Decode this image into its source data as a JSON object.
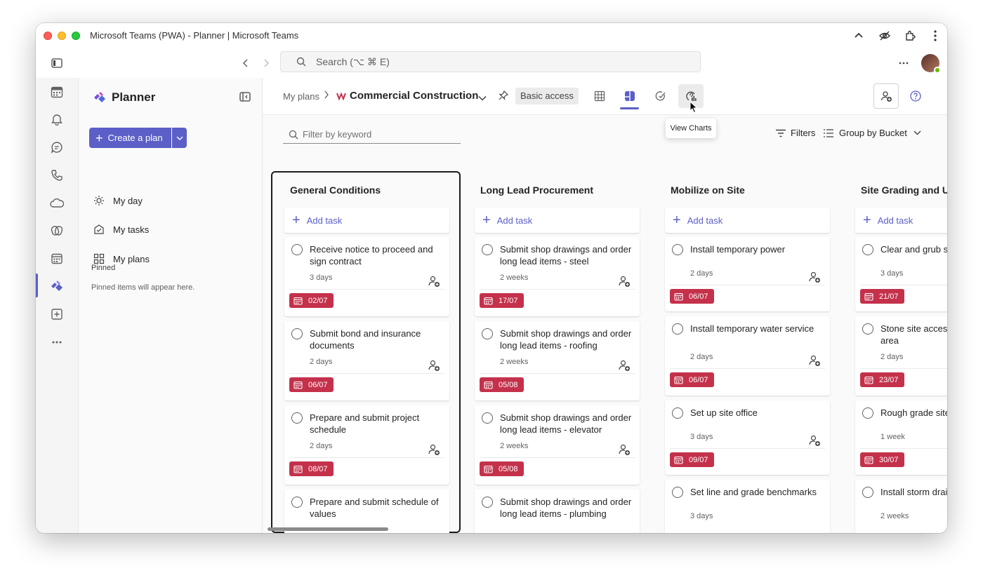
{
  "window": {
    "title": "Microsoft Teams (PWA) - Planner | Microsoft Teams"
  },
  "search": {
    "placeholder": "Search (⌥ ⌘ E)"
  },
  "rail": {
    "items": [
      "calendar-icon",
      "bell-icon",
      "chat-icon",
      "phone-icon",
      "cloud-icon",
      "loop-icon",
      "calendar-grid-icon",
      "planner-icon",
      "add-app-icon",
      "more-icon"
    ],
    "active": "planner-icon"
  },
  "sidebar": {
    "title": "Planner",
    "create_label": "Create a plan",
    "nav": [
      {
        "label": "My day",
        "icon": "sun-icon"
      },
      {
        "label": "My tasks",
        "icon": "tasks-icon"
      },
      {
        "label": "My plans",
        "icon": "grid-icon"
      }
    ],
    "pinned_heading": "Pinned",
    "pinned_empty": "Pinned items will appear here."
  },
  "header": {
    "breadcrumb": "My plans",
    "plan_name": "Commercial Construction",
    "access_badge": "Basic access",
    "tooltip": "View Charts",
    "active_view": "board"
  },
  "toolbar": {
    "filter_placeholder": "Filter by keyword",
    "filters_label": "Filters",
    "groupby_label": "Group by Bucket"
  },
  "colors": {
    "accent": "#5b5fc7",
    "due_overdue": "#c4314b"
  },
  "buckets": [
    {
      "title": "General Conditions",
      "add_label": "Add task",
      "tasks": [
        {
          "title": "Receive notice to proceed and sign contract",
          "duration": "3 days",
          "due": "02/07"
        },
        {
          "title": "Submit bond and insurance documents",
          "duration": "2 days",
          "due": "06/07"
        },
        {
          "title": "Prepare and submit project schedule",
          "duration": "2 days",
          "due": "08/07"
        },
        {
          "title": "Prepare and submit schedule of values",
          "duration": "",
          "due": ""
        }
      ]
    },
    {
      "title": "Long Lead Procurement",
      "add_label": "Add task",
      "tasks": [
        {
          "title": "Submit shop drawings and order long lead items - steel",
          "duration": "2 weeks",
          "due": "17/07"
        },
        {
          "title": "Submit shop drawings and order long lead items - roofing",
          "duration": "2 weeks",
          "due": "05/08"
        },
        {
          "title": "Submit shop drawings and order long lead items - elevator",
          "duration": "2 weeks",
          "due": "05/08"
        },
        {
          "title": "Submit shop drawings and order long lead items - plumbing",
          "duration": "",
          "due": ""
        }
      ]
    },
    {
      "title": "Mobilize on Site",
      "add_label": "Add task",
      "tasks": [
        {
          "title": "Install temporary power",
          "duration": "2 days",
          "due": "06/07"
        },
        {
          "title": "Install temporary water service",
          "duration": "2 days",
          "due": "06/07"
        },
        {
          "title": "Set up site office",
          "duration": "3 days",
          "due": "09/07"
        },
        {
          "title": "Set line and grade benchmarks",
          "duration": "3 days",
          "due": ""
        }
      ]
    },
    {
      "title": "Site Grading and Ut",
      "add_label": "Add task",
      "tasks": [
        {
          "title": "Clear and grub sit",
          "duration": "3 days",
          "due": "21/07"
        },
        {
          "title": "Stone site access a parking area",
          "duration": "2 days",
          "due": "23/07"
        },
        {
          "title": "Rough grade site",
          "duration": "1 week",
          "due": "30/07"
        },
        {
          "title": "Install storm drain",
          "duration": "2 weeks",
          "due": ""
        }
      ]
    }
  ]
}
